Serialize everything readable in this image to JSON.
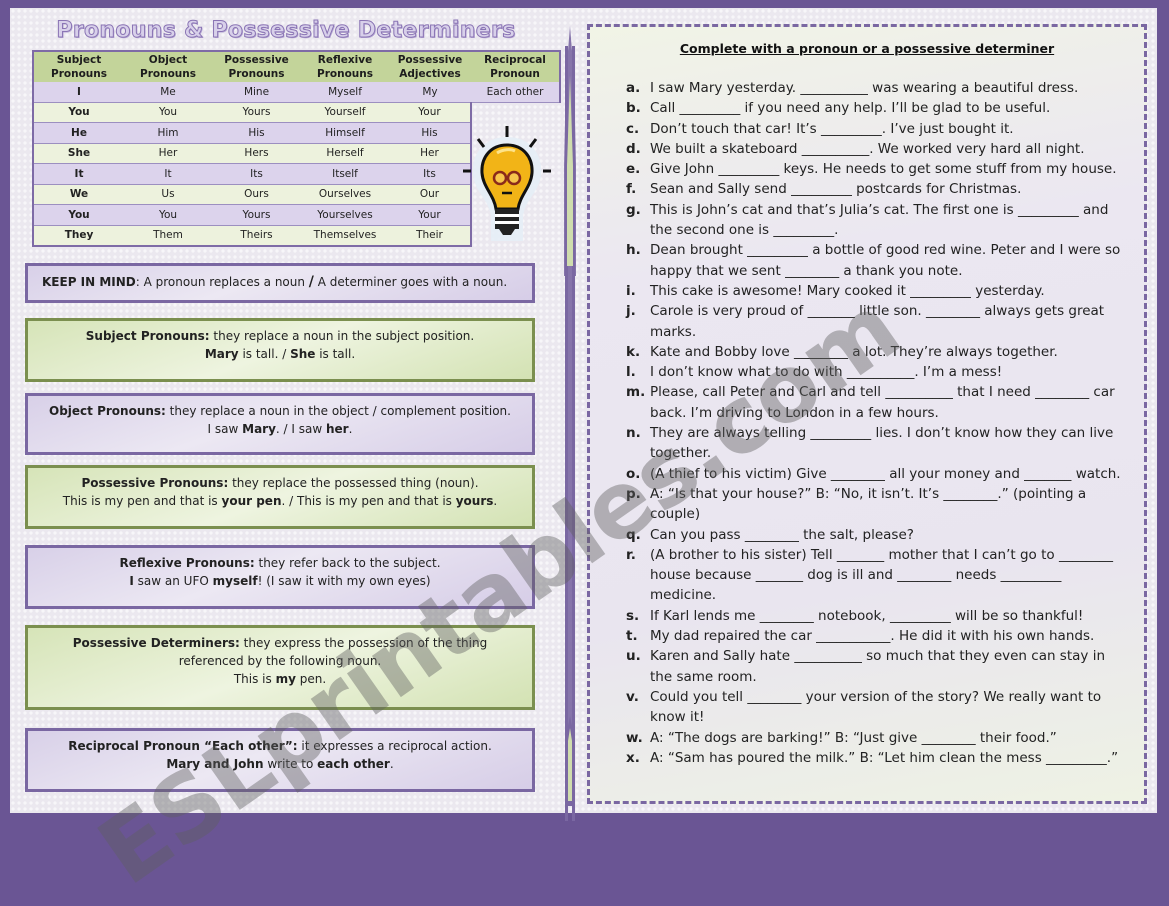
{
  "title": "Pronouns & Possessive Determiners",
  "table": {
    "headers": [
      "Subject Pronouns",
      "Object Pronouns",
      "Possessive Pronouns",
      "Reflexive Pronouns",
      "Possessive Adjectives",
      "Reciprocal Pronoun"
    ],
    "rows": [
      [
        "I",
        "Me",
        "Mine",
        "Myself",
        "My",
        "Each other"
      ],
      [
        "You",
        "You",
        "Yours",
        "Yourself",
        "Your",
        ""
      ],
      [
        "He",
        "Him",
        "His",
        "Himself",
        "His",
        ""
      ],
      [
        "She",
        "Her",
        "Hers",
        "Herself",
        "Her",
        ""
      ],
      [
        "It",
        "It",
        "Its",
        "Itself",
        "Its",
        ""
      ],
      [
        "We",
        "Us",
        "Ours",
        "Ourselves",
        "Our",
        ""
      ],
      [
        "You",
        "You",
        "Yours",
        "Yourselves",
        "Your",
        ""
      ],
      [
        "They",
        "Them",
        "Theirs",
        "Themselves",
        "Their",
        ""
      ]
    ]
  },
  "illustration": "lightbulb-with-glasses",
  "boxes": {
    "keep": {
      "label": "KEEP IN MIND",
      "text1": ": A pronoun replaces a noun ",
      "slash": "/",
      "text2": " A determiner goes with a noun."
    },
    "subject": {
      "label": "Subject Pronouns:",
      "text": "  they replace a noun in the subject position.",
      "ex_a": "Mary",
      "ex_b": " is tall. / ",
      "ex_c": "She",
      "ex_d": " is tall."
    },
    "object": {
      "label": "Object  Pronouns:",
      "text": "  they replace a noun in the object / complement position.",
      "ex_a": "I saw ",
      "ex_b": "Mary",
      "ex_c": ". / I saw ",
      "ex_d": "her",
      "ex_e": "."
    },
    "possessive": {
      "label": "Possessive Pronouns:",
      "text": "  they replace the possessed thing (noun).",
      "ex_a": "This is my pen and that is ",
      "ex_b": "your pen",
      "ex_c": ". / This is my pen and that is ",
      "ex_d": "yours",
      "ex_e": "."
    },
    "reflexive": {
      "label": "Reflexive Pronouns:",
      "text": " they refer back to the subject.",
      "ex_a": "I",
      "ex_b": " saw an UFO ",
      "ex_c": "myself",
      "ex_d": "! (I saw it with my own eyes)"
    },
    "determiners": {
      "label": "Possessive Determiners:",
      "text": " they express the possession of the thing referenced by the following noun.",
      "ex_a": "This is ",
      "ex_b": "my",
      "ex_c": " pen."
    },
    "reciprocal": {
      "label": "Reciprocal Pronoun “Each other”:",
      "text": " it expresses a reciprocal action.",
      "ex_a": "Mary and John",
      "ex_b": " write to ",
      "ex_c": "each other",
      "ex_d": "."
    }
  },
  "exercise": {
    "title": "Complete with a pronoun or a possessive determiner",
    "items": [
      {
        "letter": "a.",
        "text": "I saw Mary yesterday. __________ was wearing a beautiful dress."
      },
      {
        "letter": "b.",
        "text": "Call _________ if you need any help. I’ll be glad to be useful."
      },
      {
        "letter": "c.",
        "text": "Don’t touch that car! It’s _________. I’ve just bought it."
      },
      {
        "letter": "d.",
        "text": "We built a skateboard __________. We worked very hard all night."
      },
      {
        "letter": "e.",
        "text": "Give John _________ keys. He needs to get some stuff from my house."
      },
      {
        "letter": "f.",
        "text": "Sean and Sally send _________ postcards for Christmas."
      },
      {
        "letter": "g.",
        "text": "This is John’s cat and that’s Julia’s cat. The first one is _________ and the second one is _________."
      },
      {
        "letter": "h.",
        "text": "Dean brought _________ a bottle of good red wine. Peter and I were so happy that we sent ________ a thank you note."
      },
      {
        "letter": "i.",
        "text": "This cake is awesome! Mary cooked it _________ yesterday."
      },
      {
        "letter": "j.",
        "text": "Carole is very proud of _______ little son. ________ always gets great marks."
      },
      {
        "letter": "k.",
        "text": "Kate and Bobby love ________ a lot. They’re always together."
      },
      {
        "letter": "l.",
        "text": "I don’t know what to do with __________. I’m a mess!"
      },
      {
        "letter": "m.",
        "text": "Please, call Peter and Carl and tell __________ that I need ________ car back. I’m driving to London in a few hours."
      },
      {
        "letter": "n.",
        "text": "They are always telling _________ lies. I don’t know how they can live together."
      },
      {
        "letter": "o.",
        "text": "(A thief to his victim) Give ________ all your money and _______ watch."
      },
      {
        "letter": "p.",
        "text": "A: “Is that your house?” B: “No, it isn’t. It’s ________.” (pointing a couple)"
      },
      {
        "letter": "q.",
        "text": "Can you pass ________ the salt, please?"
      },
      {
        "letter": "r.",
        "text": "(A brother to his sister) Tell _______ mother that I can’t go to ________ house because _______ dog is ill and ________ needs _________ medicine."
      },
      {
        "letter": "s.",
        "text": "If Karl lends me ________ notebook, _________ will be so thankful!"
      },
      {
        "letter": "t.",
        "text": "My dad repaired the car ___________. He did it with his own hands."
      },
      {
        "letter": "u.",
        "text": "Karen and Sally hate __________ so much that they even can stay in the same room."
      },
      {
        "letter": "v.",
        "text": "Could you tell ________ your version of the story? We really want to know it!"
      },
      {
        "letter": "w.",
        "text": "A: “The dogs are barking!” B: “Just give ________ their food.”"
      },
      {
        "letter": "x.",
        "text": "A: “Sam has poured the milk.” B: “Let him clean the mess _________.”"
      }
    ]
  },
  "watermark": "ESLprintables.com",
  "colors": {
    "frame": "#6a5594",
    "purple_border": "#7a67a2",
    "green_border": "#7b8f4f",
    "table_header": "#c3d49a",
    "bulb": "#f2b417"
  }
}
